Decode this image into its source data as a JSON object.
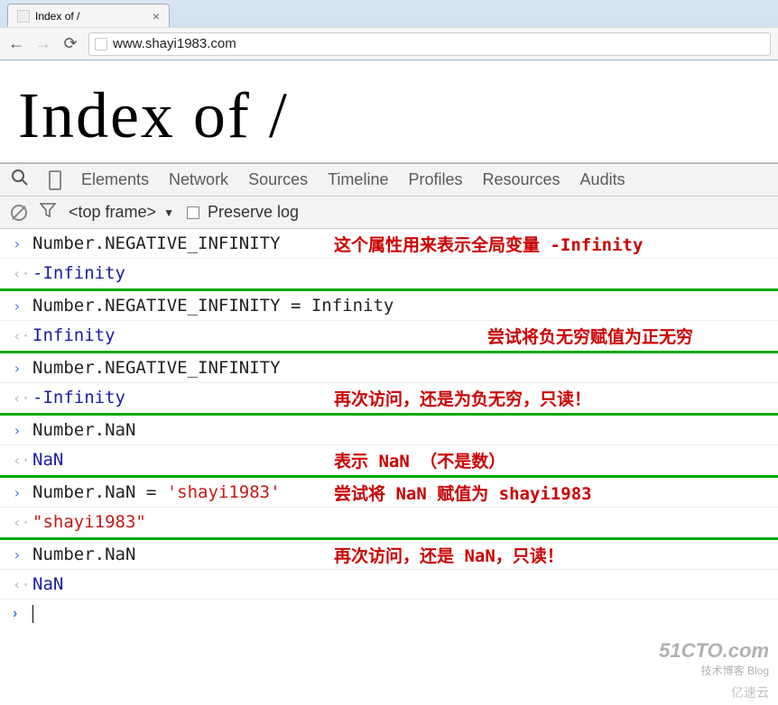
{
  "browser": {
    "tab_title": "Index of /",
    "url": "www.shayi1983.com"
  },
  "page": {
    "heading": "Index of /"
  },
  "devtools": {
    "tabs": [
      "Elements",
      "Network",
      "Sources",
      "Timeline",
      "Profiles",
      "Resources",
      "Audits"
    ],
    "frame_selector": "<top frame>",
    "preserve_log_label": "Preserve log"
  },
  "console": {
    "entries": [
      {
        "type": "input",
        "code": "Number.NEGATIVE_INFINITY",
        "annotation": "这个属性用来表示全局变量 -Infinity",
        "ann_pos": "near"
      },
      {
        "type": "output",
        "result": "-Infinity",
        "resultClass": "num",
        "sep": true
      },
      {
        "type": "input",
        "code": "Number.NEGATIVE_INFINITY = Infinity"
      },
      {
        "type": "output",
        "result": "Infinity",
        "resultClass": "num",
        "sep": true,
        "annotation": "尝试将负无穷赋值为正无穷",
        "ann_pos": "far"
      },
      {
        "type": "input",
        "code": "Number.NEGATIVE_INFINITY"
      },
      {
        "type": "output",
        "result": "-Infinity",
        "resultClass": "num",
        "sep": true,
        "annotation": "再次访问，还是为负无穷，只读！",
        "ann_pos": "near"
      },
      {
        "type": "input",
        "code": "Number.NaN",
        "annotation": "",
        "ann_pos": "near"
      },
      {
        "type": "output",
        "result": "NaN",
        "resultClass": "num",
        "sep": true,
        "annotation": "表示 NaN （不是数）",
        "ann_pos": "near"
      },
      {
        "type": "input",
        "code": "Number.NaN = 'shayi1983'",
        "annotation": "尝试将 NaN 赋值为 shayi1983",
        "ann_pos": "near"
      },
      {
        "type": "output",
        "result": "\"shayi1983\"",
        "resultClass": "str",
        "sep": true
      },
      {
        "type": "input",
        "code": "Number.NaN",
        "annotation": "再次访问，还是 NaN，只读！",
        "ann_pos": "near"
      },
      {
        "type": "output",
        "result": "NaN",
        "resultClass": "num",
        "sep": false
      }
    ]
  },
  "watermark": {
    "brand": "51CTO.com",
    "tagline": "技术博客  Blog",
    "secondary": "亿速云"
  }
}
